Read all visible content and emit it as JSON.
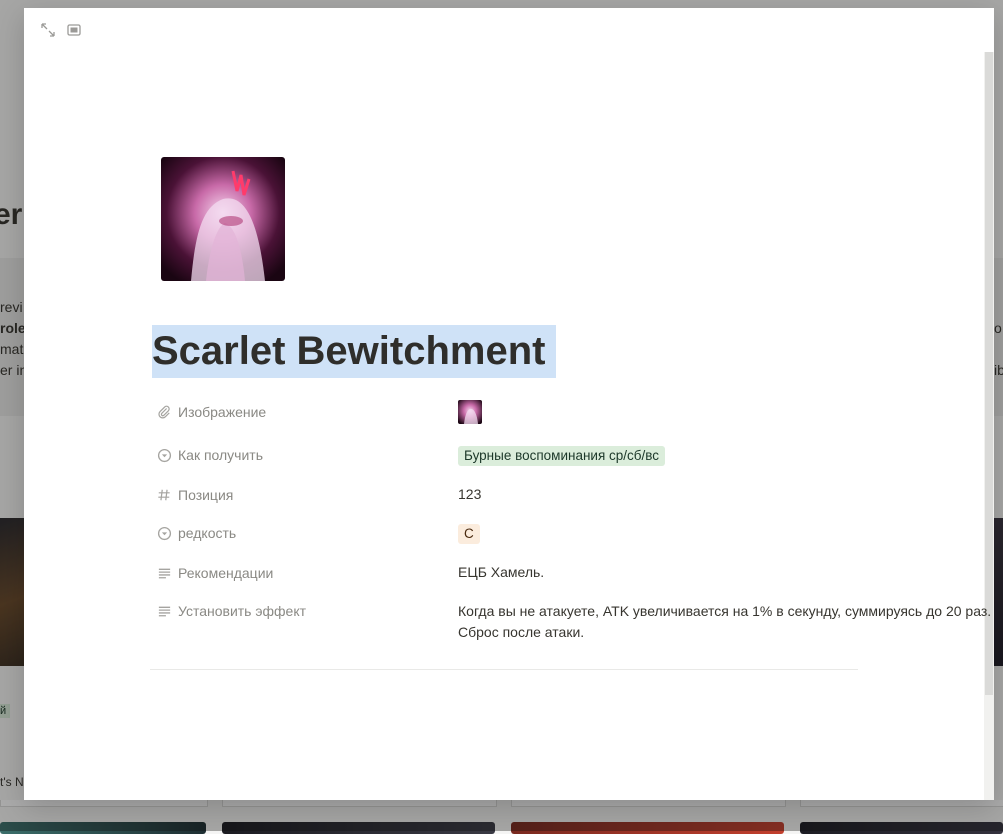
{
  "page": {
    "title": "Scarlet Bewitchment"
  },
  "properties": [
    {
      "name": "Изображение",
      "icon": "paperclip-icon",
      "type": "image"
    },
    {
      "name": "Как получить",
      "icon": "select-icon",
      "type": "tag",
      "value": "Бурные воспоминания ср/сб/вс",
      "color": "#dbeddb"
    },
    {
      "name": "Позиция",
      "icon": "number-icon",
      "type": "text",
      "value": "123"
    },
    {
      "name": "редкость",
      "icon": "select-icon",
      "type": "tag",
      "value": "C",
      "color": "#fbecdd"
    },
    {
      "name": "Рекомендации",
      "icon": "text-icon",
      "type": "text",
      "value": "ЕЦБ Хамель."
    },
    {
      "name": "Установить эффект",
      "icon": "text-icon",
      "type": "text",
      "value_lines": [
        "Когда вы не атакуете, ATK увеличивается на 1% в секунду, суммируясь до 20 раз.",
        "Сброс после атаки."
      ]
    }
  ],
  "background": {
    "title_fragment": "er",
    "callout_lines": [
      "revi",
      "role",
      "mat",
      "er in"
    ],
    "callout_lines_right": [
      "o",
      "",
      "ib"
    ],
    "tag_fragment": "й",
    "bottom_fragment": "t's N"
  },
  "colors": {
    "accent_selection": "#cfe2f7",
    "tag_green": "#dbeddb",
    "tag_orange": "#fbecdd"
  }
}
